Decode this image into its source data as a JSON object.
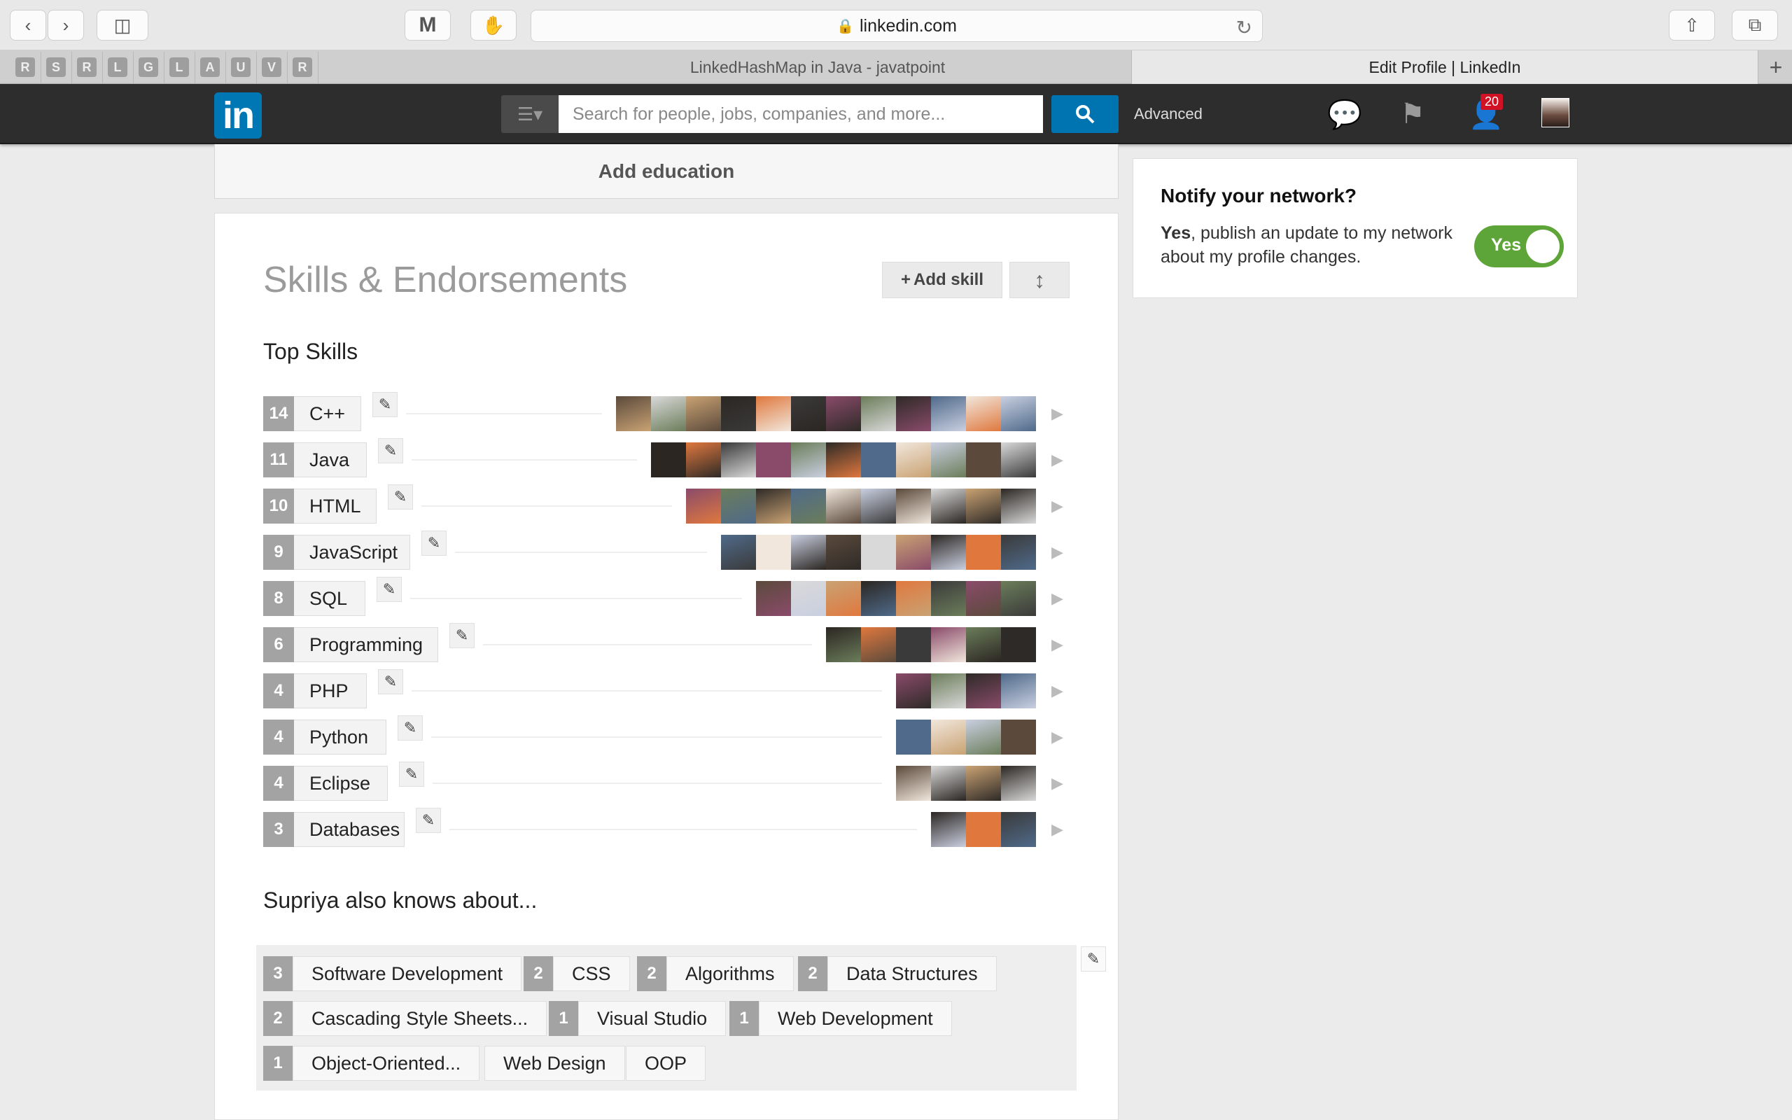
{
  "browser": {
    "url": "linkedin.com",
    "pinned_tabs": [
      "R",
      "S",
      "R",
      "L",
      "G",
      "L",
      "A",
      "U",
      "V",
      "R"
    ],
    "tabs": [
      {
        "title": "LinkedHashMap in Java - javatpoint"
      },
      {
        "title": "Edit Profile | LinkedIn"
      }
    ]
  },
  "nav": {
    "logo_text": "in",
    "search_placeholder": "Search for people, jobs, companies, and more...",
    "advanced": "Advanced",
    "notification_count": "20"
  },
  "education": {
    "add_label": "Add education"
  },
  "skills": {
    "title": "Skills & Endorsements",
    "add_skill": "Add skill",
    "top_heading": "Top Skills",
    "top": [
      {
        "count": "14",
        "name": "C++"
      },
      {
        "count": "11",
        "name": "Java"
      },
      {
        "count": "10",
        "name": "HTML"
      },
      {
        "count": "9",
        "name": "JavaScript"
      },
      {
        "count": "8",
        "name": "SQL"
      },
      {
        "count": "6",
        "name": "Programming"
      },
      {
        "count": "4",
        "name": "PHP"
      },
      {
        "count": "4",
        "name": "Python"
      },
      {
        "count": "4",
        "name": "Eclipse"
      },
      {
        "count": "3",
        "name": "Databases"
      }
    ],
    "also_heading": "Supriya also knows about...",
    "also": [
      {
        "count": "3",
        "name": "Software Development"
      },
      {
        "count": "2",
        "name": "CSS"
      },
      {
        "count": "2",
        "name": "Algorithms"
      },
      {
        "count": "2",
        "name": "Data Structures"
      },
      {
        "count": "2",
        "name": "Cascading Style Sheets..."
      },
      {
        "count": "1",
        "name": "Visual Studio"
      },
      {
        "count": "1",
        "name": "Web Development"
      },
      {
        "count": "1",
        "name": "Object-Oriented..."
      },
      {
        "count": "",
        "name": "Web Design"
      },
      {
        "count": "",
        "name": "OOP"
      }
    ]
  },
  "notify": {
    "title": "Notify your network?",
    "text_bold": "Yes",
    "text_rest": ", publish an update to my network about my profile changes.",
    "toggle_label": "Yes"
  }
}
